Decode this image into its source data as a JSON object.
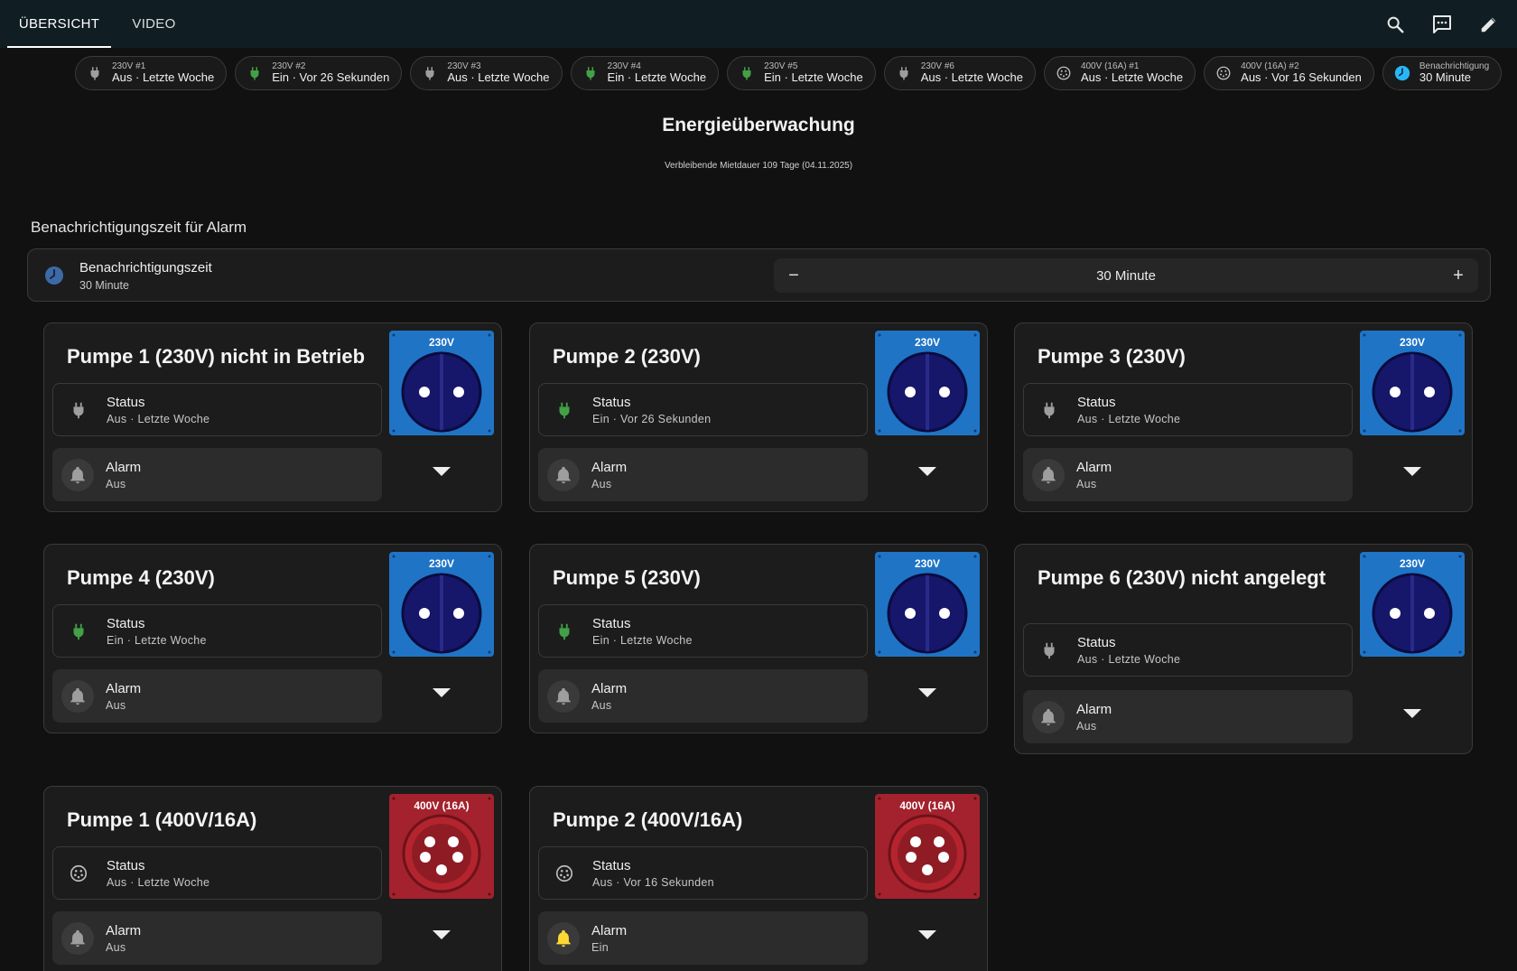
{
  "header": {
    "tabs": [
      {
        "label": "ÜBERSICHT",
        "active": true
      },
      {
        "label": "VIDEO",
        "active": false
      }
    ],
    "icons": [
      "search-icon",
      "chat-icon",
      "edit-icon"
    ]
  },
  "badges": [
    {
      "name": "230V #1",
      "state": "Aus · Letzte Woche",
      "icon": "plug-icon",
      "color": "#9e9e9e"
    },
    {
      "name": "230V #2",
      "state": "Ein · Vor 26 Sekunden",
      "icon": "plug-icon",
      "color": "#43a047"
    },
    {
      "name": "230V #3",
      "state": "Aus · Letzte Woche",
      "icon": "plug-icon",
      "color": "#9e9e9e"
    },
    {
      "name": "230V #4",
      "state": "Ein · Letzte Woche",
      "icon": "plug-icon",
      "color": "#43a047"
    },
    {
      "name": "230V #5",
      "state": "Ein · Letzte Woche",
      "icon": "plug-icon",
      "color": "#43a047"
    },
    {
      "name": "230V #6",
      "state": "Aus · Letzte Woche",
      "icon": "plug-icon",
      "color": "#9e9e9e"
    },
    {
      "name": "400V (16A) #1",
      "state": "Aus · Letzte Woche",
      "icon": "cee-socket-icon",
      "color": "#bdbdbd"
    },
    {
      "name": "400V (16A) #2",
      "state": "Aus · Vor 16 Sekunden",
      "icon": "cee-socket-icon",
      "color": "#bdbdbd"
    },
    {
      "name": "Benachrichtigung",
      "state": "30 Minute",
      "icon": "clock-icon",
      "color": "#29b6f6"
    }
  ],
  "page": {
    "title": "Energieüberwachung",
    "subtitle": "Verbleibende Mietdauer 109 Tage (04.11.2025)"
  },
  "alarm_section": {
    "title": "Benachrichtigungszeit für Alarm",
    "entity_name": "Benachrichtigungszeit",
    "entity_value": "30 Minute",
    "stepper_value": "30 Minute",
    "minus_label": "−",
    "plus_label": "+",
    "icon_color": "#4a7ab5"
  },
  "pumps": [
    {
      "title": "Pumpe 1 (230V) nicht in Betrieb",
      "socket_type": "230v",
      "socket_label": "230V",
      "status_name": "Status",
      "status_value": "Aus · Letzte Woche",
      "status_icon": "plug-icon",
      "status_color": "#9e9e9e",
      "alarm_name": "Alarm",
      "alarm_value": "Aus",
      "alarm_color": "#9e9e9e"
    },
    {
      "title": "Pumpe 2 (230V)",
      "socket_type": "230v",
      "socket_label": "230V",
      "status_name": "Status",
      "status_value": "Ein · Vor 26 Sekunden",
      "status_icon": "plug-icon",
      "status_color": "#43a047",
      "alarm_name": "Alarm",
      "alarm_value": "Aus",
      "alarm_color": "#9e9e9e"
    },
    {
      "title": "Pumpe 3 (230V)",
      "socket_type": "230v",
      "socket_label": "230V",
      "status_name": "Status",
      "status_value": "Aus · Letzte Woche",
      "status_icon": "plug-icon",
      "status_color": "#9e9e9e",
      "alarm_name": "Alarm",
      "alarm_value": "Aus",
      "alarm_color": "#9e9e9e"
    },
    {
      "title": "Pumpe 4 (230V)",
      "socket_type": "230v",
      "socket_label": "230V",
      "status_name": "Status",
      "status_value": "Ein · Letzte Woche",
      "status_icon": "plug-icon",
      "status_color": "#43a047",
      "alarm_name": "Alarm",
      "alarm_value": "Aus",
      "alarm_color": "#9e9e9e"
    },
    {
      "title": "Pumpe 5 (230V)",
      "socket_type": "230v",
      "socket_label": "230V",
      "status_name": "Status",
      "status_value": "Ein · Letzte Woche",
      "status_icon": "plug-icon",
      "status_color": "#43a047",
      "alarm_name": "Alarm",
      "alarm_value": "Aus",
      "alarm_color": "#9e9e9e"
    },
    {
      "title": "Pumpe 6 (230V) nicht angelegt",
      "socket_type": "230v",
      "socket_label": "230V",
      "status_name": "Status",
      "status_value": "Aus · Letzte Woche",
      "status_icon": "plug-icon",
      "status_color": "#9e9e9e",
      "alarm_name": "Alarm",
      "alarm_value": "Aus",
      "alarm_color": "#9e9e9e"
    },
    {
      "title": "Pumpe 1 (400V/16A)",
      "socket_type": "400v",
      "socket_label": "400V (16A)",
      "status_name": "Status",
      "status_value": "Aus · Letzte Woche",
      "status_icon": "cee-socket-icon",
      "status_color": "#bdbdbd",
      "alarm_name": "Alarm",
      "alarm_value": "Aus",
      "alarm_color": "#9e9e9e"
    },
    {
      "title": "Pumpe 2 (400V/16A)",
      "socket_type": "400v",
      "socket_label": "400V (16A)",
      "status_name": "Status",
      "status_value": "Aus · Vor 16 Sekunden",
      "status_icon": "cee-socket-icon",
      "status_color": "#bdbdbd",
      "alarm_name": "Alarm",
      "alarm_value": "Ein",
      "alarm_color": "#fdd835"
    }
  ]
}
